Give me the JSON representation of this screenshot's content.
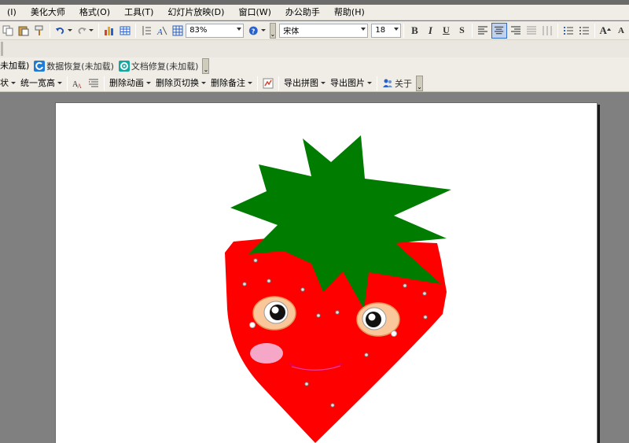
{
  "menu": {
    "items": [
      {
        "name": "menu-item-insert-partial",
        "label": "(I)"
      },
      {
        "name": "menu-item-beautify",
        "label": "美化大师"
      },
      {
        "name": "menu-item-format",
        "label": "格式(O)"
      },
      {
        "name": "menu-item-tools",
        "label": "工具(T)"
      },
      {
        "name": "menu-item-slideshow",
        "label": "幻灯片放映(D)"
      },
      {
        "name": "menu-item-window",
        "label": "窗口(W)"
      },
      {
        "name": "menu-item-office-assistant",
        "label": "办公助手"
      },
      {
        "name": "menu-item-help",
        "label": "帮助(H)"
      }
    ]
  },
  "format_toolbar": {
    "zoom_value": "83%",
    "font_name": "宋体",
    "font_size": "18",
    "bold_label": "B",
    "italic_label": "I",
    "underline_label": "U",
    "shadow_label": "S",
    "increase_font_label": "A",
    "grip_label": "⌄"
  },
  "plugin_bar": {
    "unloaded_partial": "未加载)",
    "data_recovery": "数据恢复(未加载)",
    "doc_repair": "文档修复(未加载)"
  },
  "beautify_bar": {
    "shape_partial": "状",
    "unify_size": "统一宽高",
    "delete_animation": "删除动画",
    "delete_transition": "删除页切换",
    "delete_notes": "删除备注",
    "export_collage": "导出拼图",
    "export_images": "导出图片",
    "about": "关于"
  },
  "colors": {
    "strawberry_body": "#ff0000",
    "leaves": "#007d00",
    "eye_ring": "#f9c79a",
    "cheek": "#f6a6c6",
    "mouth": "#e0005a",
    "toolbar_bg": "#efede6",
    "workspace_bg": "#808080"
  }
}
